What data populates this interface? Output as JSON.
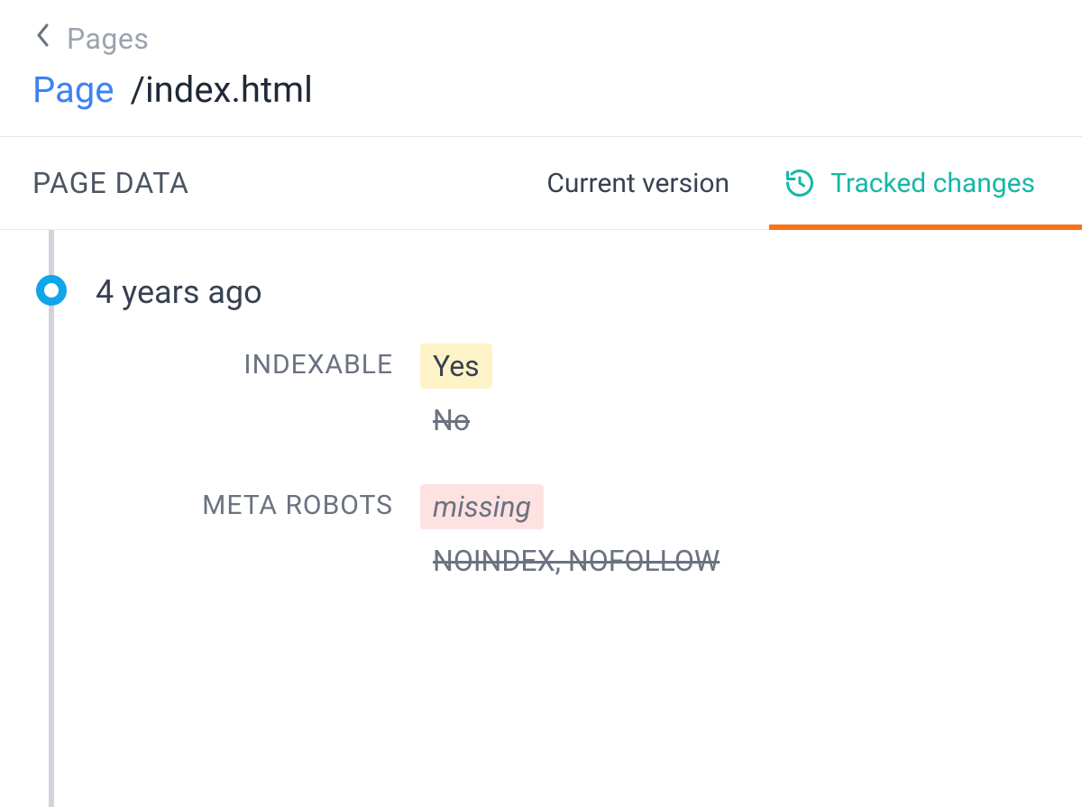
{
  "breadcrumb": {
    "parent": "Pages"
  },
  "title": {
    "label": "Page",
    "value": "/index.html"
  },
  "section": {
    "title": "PAGE DATA",
    "tabs": {
      "current": "Current version",
      "changes": "Tracked changes"
    }
  },
  "event": {
    "time": "4 years ago"
  },
  "changes": [
    {
      "label": "INDEXABLE",
      "new": "Yes",
      "old": "No",
      "style": "yellow"
    },
    {
      "label": "META ROBOTS",
      "new": "missing",
      "old": "NOINDEX, NOFOLLOW",
      "style": "red",
      "italic": true
    }
  ]
}
